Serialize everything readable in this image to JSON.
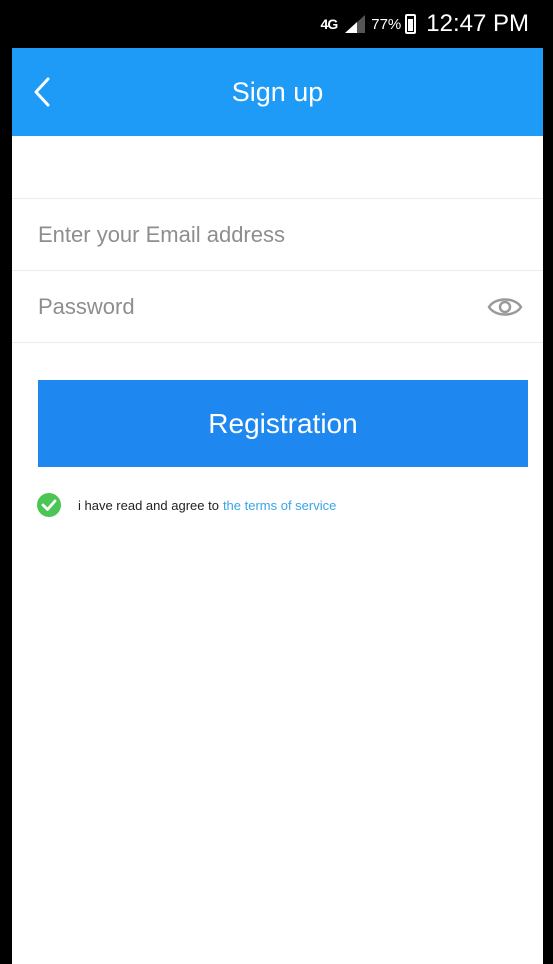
{
  "status_bar": {
    "network": "4G",
    "battery": "77%",
    "time": "12:47 PM"
  },
  "app_bar": {
    "title": "Sign up",
    "back_icon": "chevron-left-icon"
  },
  "form": {
    "email_placeholder": "Enter your Email address",
    "password_placeholder": "Password",
    "password_toggle_icon": "eye-icon"
  },
  "register_button": {
    "label": "Registration"
  },
  "agreement": {
    "check_icon": "check-circle-icon",
    "text": "i have read and agree to",
    "link_text": "the terms of service"
  },
  "colors": {
    "app_bar": "#1e9bf7",
    "button": "#1e88f0",
    "check": "#4cc557",
    "link": "#3aa5e6"
  }
}
